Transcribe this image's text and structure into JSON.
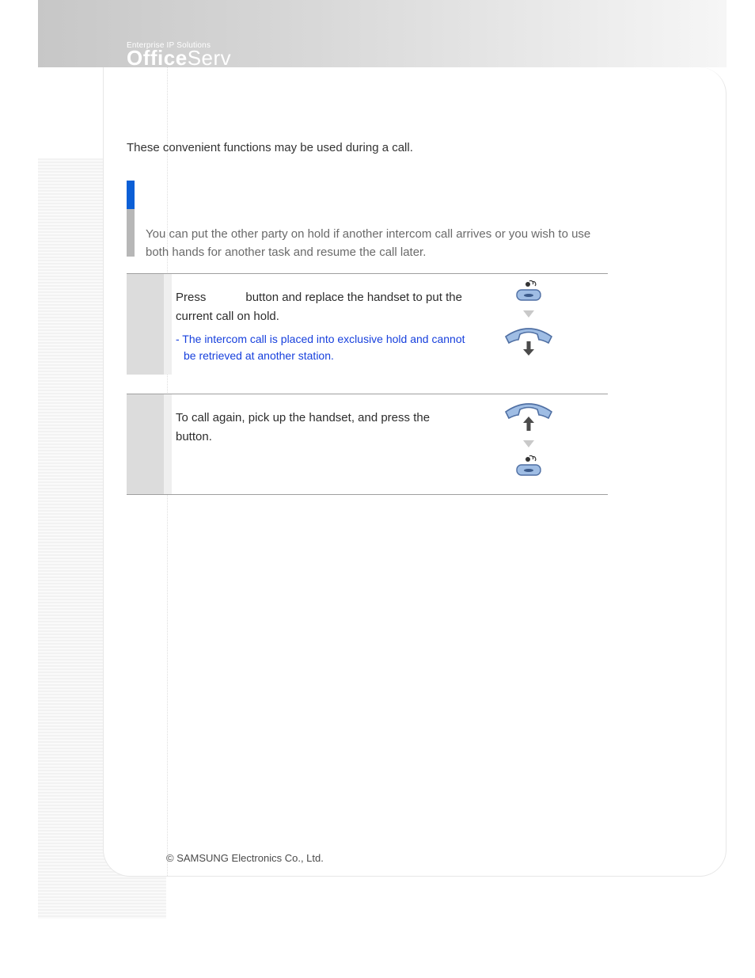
{
  "brand": {
    "tagline": "Enterprise IP Solutions",
    "logo_bold": "Off",
    "logo_dot": "i",
    "logo_bold2": "ce",
    "logo_thin": "Serv"
  },
  "intro": "These convenient functions may be used during a call.",
  "hold": {
    "desc": "You can put the other party on hold if another intercom call arrives or you wish to use both hands for another task and resume the call later."
  },
  "step1": {
    "t1": "Press ",
    "t2": " button and replace the handset to put the current call on hold.",
    "note": "- The intercom call is placed into exclusive hold and cannot be retrieved at another station."
  },
  "step2": {
    "t1": "To call again, pick up the handset, and press the ",
    "t2": " button."
  },
  "footer": "© SAMSUNG Electronics Co., Ltd."
}
